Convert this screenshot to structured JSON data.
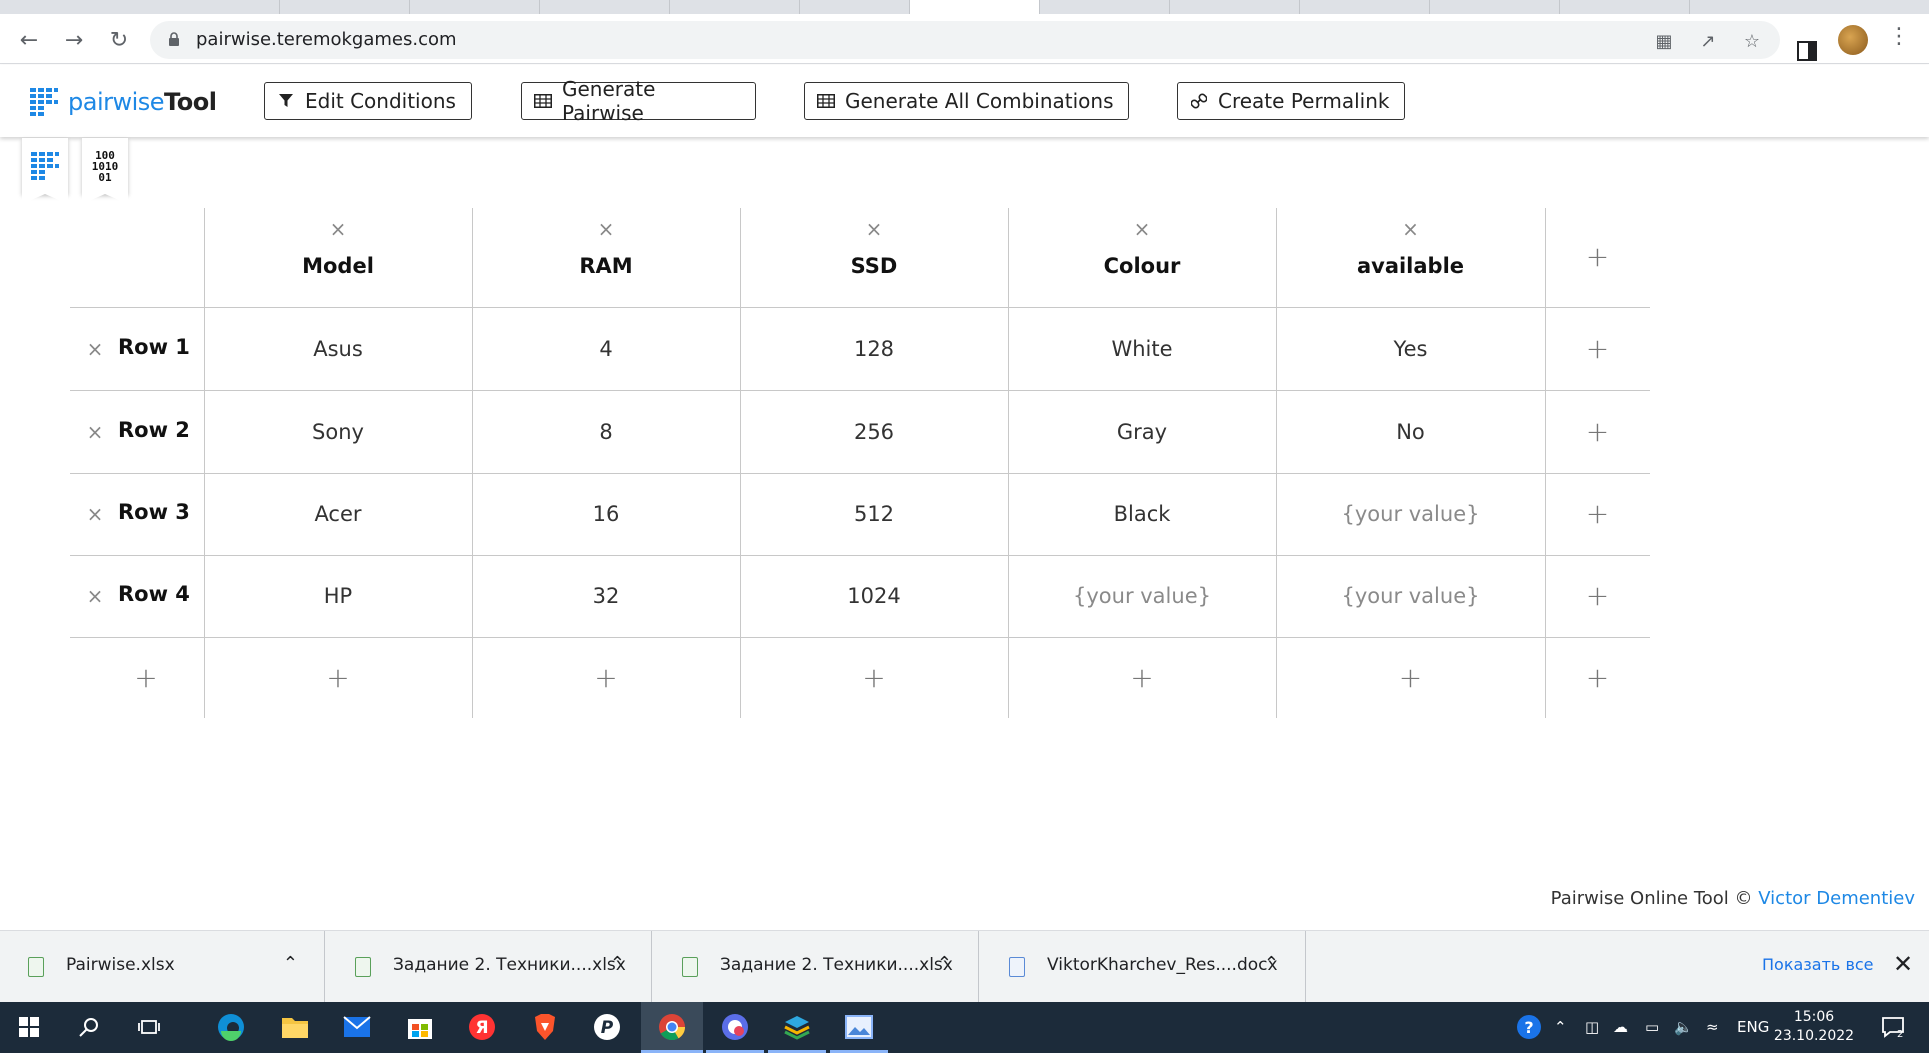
{
  "browser": {
    "url": "pairwise.teremokgames.com"
  },
  "app": {
    "logo_light": "pairwise",
    "logo_bold": "Tool",
    "buttons": {
      "edit_conditions": "Edit Conditions",
      "generate_pairwise": "Generate Pairwise",
      "generate_all": "Generate All Combinations",
      "create_permalink": "Create Permalink"
    },
    "binary_tab_lines": [
      "100",
      "1010",
      "01"
    ]
  },
  "table": {
    "columns": [
      "Model",
      "RAM",
      "SSD",
      "Colour",
      "available"
    ],
    "rows": [
      {
        "label": "Row 1",
        "cells": [
          "Asus",
          "4",
          "128",
          "White",
          "Yes"
        ]
      },
      {
        "label": "Row 2",
        "cells": [
          "Sony",
          "8",
          "256",
          "Gray",
          "No"
        ]
      },
      {
        "label": "Row 3",
        "cells": [
          "Acer",
          "16",
          "512",
          "Black",
          "{your value}"
        ]
      },
      {
        "label": "Row 4",
        "cells": [
          "HP",
          "32",
          "1024",
          "{your value}",
          "{your value}"
        ]
      }
    ],
    "placeholder": "{your value}"
  },
  "footer": {
    "text": "Pairwise Online Tool ©",
    "author": "Victor Dementiev"
  },
  "downloads": {
    "items": [
      {
        "name": "Pairwise.xlsx",
        "type": "xlsx"
      },
      {
        "name": "Задание 2. Техники....xlsx",
        "type": "xlsx"
      },
      {
        "name": "Задание 2. Техники....xlsx",
        "type": "xlsx"
      },
      {
        "name": "ViktorKharchev_Res....docx",
        "type": "docx"
      }
    ],
    "show_all": "Показать все"
  },
  "taskbar": {
    "lang": "ENG",
    "time": "15:06",
    "date": "23.10.2022",
    "notifications": "2"
  }
}
